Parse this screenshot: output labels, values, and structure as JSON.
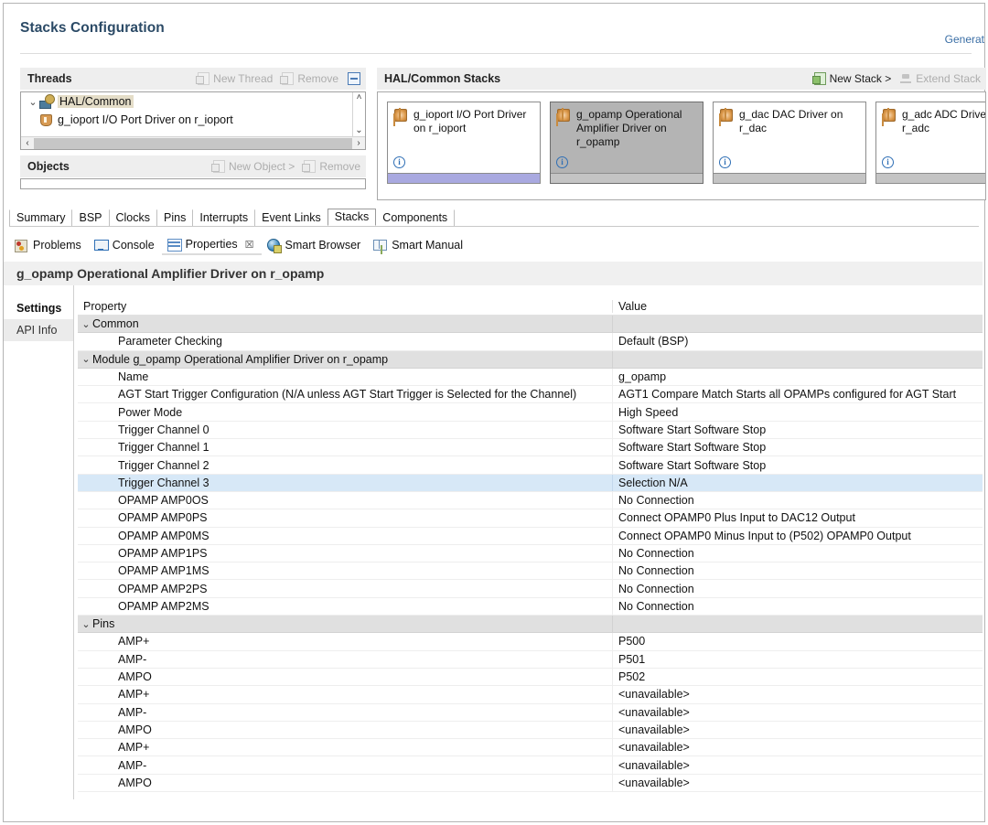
{
  "page": {
    "title": "Stacks Configuration",
    "generate_link": "Generat"
  },
  "threads_panel": {
    "title": "Threads",
    "new_thread_label": "New Thread",
    "remove_label": "Remove",
    "collapse_icon": "collapse-all-icon",
    "tree": [
      {
        "label": "HAL/Common",
        "icon": "hal-common-icon",
        "expanded": true,
        "selected": true
      },
      {
        "label": "g_ioport I/O Port Driver on r_ioport",
        "icon": "driver-shield-icon",
        "selected": false
      }
    ]
  },
  "objects_panel": {
    "title": "Objects",
    "new_object_label": "New Object >",
    "remove_label": "Remove"
  },
  "stacks_panel": {
    "title": "HAL/Common Stacks",
    "new_stack_label": "New Stack >",
    "extend_stack_label": "Extend Stack",
    "cards": [
      {
        "label": "g_ioport I/O Port Driver on r_ioport",
        "selected": false,
        "footer": "blue",
        "info_icon": "info-icon",
        "module_icon": "module-icon"
      },
      {
        "label": "g_opamp Operational Amplifier Driver on r_opamp",
        "selected": true,
        "footer": "gray",
        "info_icon": "info-icon",
        "module_icon": "module-icon"
      },
      {
        "label": "g_dac DAC Driver on r_dac",
        "selected": false,
        "footer": "gray",
        "info_icon": "info-icon",
        "module_icon": "module-icon"
      },
      {
        "label": "g_adc ADC Driver on r_adc",
        "selected": false,
        "footer": "gray",
        "info_icon": "info-icon",
        "module_icon": "module-icon"
      }
    ]
  },
  "config_tabs": [
    {
      "label": "Summary",
      "active": false
    },
    {
      "label": "BSP",
      "active": false
    },
    {
      "label": "Clocks",
      "active": false
    },
    {
      "label": "Pins",
      "active": false
    },
    {
      "label": "Interrupts",
      "active": false
    },
    {
      "label": "Event Links",
      "active": false
    },
    {
      "label": "Stacks",
      "active": true
    },
    {
      "label": "Components",
      "active": false
    }
  ],
  "view_tabs": [
    {
      "label": "Problems",
      "icon": "problems-icon",
      "active": false,
      "closable": false
    },
    {
      "label": "Console",
      "icon": "console-icon",
      "active": false,
      "closable": false
    },
    {
      "label": "Properties",
      "icon": "properties-icon",
      "active": true,
      "closable": true,
      "close_glyph": "☒"
    },
    {
      "label": "Smart Browser",
      "icon": "smart-browser-icon",
      "active": false,
      "closable": false
    },
    {
      "label": "Smart Manual",
      "icon": "smart-manual-icon",
      "active": false,
      "closable": false
    }
  ],
  "section_title": "g_opamp Operational Amplifier Driver on r_opamp",
  "side_tabs": [
    {
      "label": "Settings",
      "active": true
    },
    {
      "label": "API Info",
      "active": false
    }
  ],
  "property_table": {
    "columns": {
      "property": "Property",
      "value": "Value"
    },
    "rows": [
      {
        "type": "group",
        "property": "Common",
        "value": "",
        "expanded": true
      },
      {
        "type": "item",
        "property": "Parameter Checking",
        "value": "Default (BSP)"
      },
      {
        "type": "group",
        "property": "Module g_opamp Operational Amplifier Driver on r_opamp",
        "value": "",
        "expanded": true
      },
      {
        "type": "item",
        "property": "Name",
        "value": "g_opamp"
      },
      {
        "type": "item",
        "property": "AGT Start Trigger Configuration (N/A unless AGT Start Trigger is Selected for the Channel)",
        "value": "AGT1 Compare Match Starts all OPAMPs configured for AGT Start"
      },
      {
        "type": "item",
        "property": "Power Mode",
        "value": "High Speed"
      },
      {
        "type": "item",
        "property": "Trigger Channel 0",
        "value": "Software Start Software Stop"
      },
      {
        "type": "item",
        "property": "Trigger Channel 1",
        "value": "Software Start Software Stop"
      },
      {
        "type": "item",
        "property": "Trigger Channel 2",
        "value": "Software Start Software Stop"
      },
      {
        "type": "item",
        "property": "Trigger Channel 3",
        "value": "Selection N/A",
        "selected": true
      },
      {
        "type": "item",
        "property": "OPAMP AMP0OS",
        "value": "No Connection"
      },
      {
        "type": "item",
        "property": "OPAMP AMP0PS",
        "value": "Connect OPAMP0 Plus Input to DAC12 Output"
      },
      {
        "type": "item",
        "property": "OPAMP AMP0MS",
        "value": "Connect OPAMP0 Minus Input to (P502) OPAMP0 Output"
      },
      {
        "type": "item",
        "property": "OPAMP AMP1PS",
        "value": "No Connection"
      },
      {
        "type": "item",
        "property": "OPAMP AMP1MS",
        "value": "No Connection"
      },
      {
        "type": "item",
        "property": "OPAMP AMP2PS",
        "value": "No Connection"
      },
      {
        "type": "item",
        "property": "OPAMP AMP2MS",
        "value": "No Connection"
      },
      {
        "type": "group",
        "property": "Pins",
        "value": "",
        "expanded": true
      },
      {
        "type": "item",
        "property": "AMP+",
        "value": "P500"
      },
      {
        "type": "item",
        "property": "AMP-",
        "value": "P501"
      },
      {
        "type": "item",
        "property": "AMPO",
        "value": "P502"
      },
      {
        "type": "item",
        "property": "AMP+",
        "value": "<unavailable>"
      },
      {
        "type": "item",
        "property": "AMP-",
        "value": "<unavailable>"
      },
      {
        "type": "item",
        "property": "AMPO",
        "value": "<unavailable>"
      },
      {
        "type": "item",
        "property": "AMP+",
        "value": "<unavailable>"
      },
      {
        "type": "item",
        "property": "AMP-",
        "value": "<unavailable>"
      },
      {
        "type": "item",
        "property": "AMPO",
        "value": "<unavailable>"
      }
    ]
  },
  "glyphs": {
    "chevron_down": "⌄",
    "chevron_up": "˄",
    "arrow_left": "‹",
    "arrow_right": "›"
  }
}
